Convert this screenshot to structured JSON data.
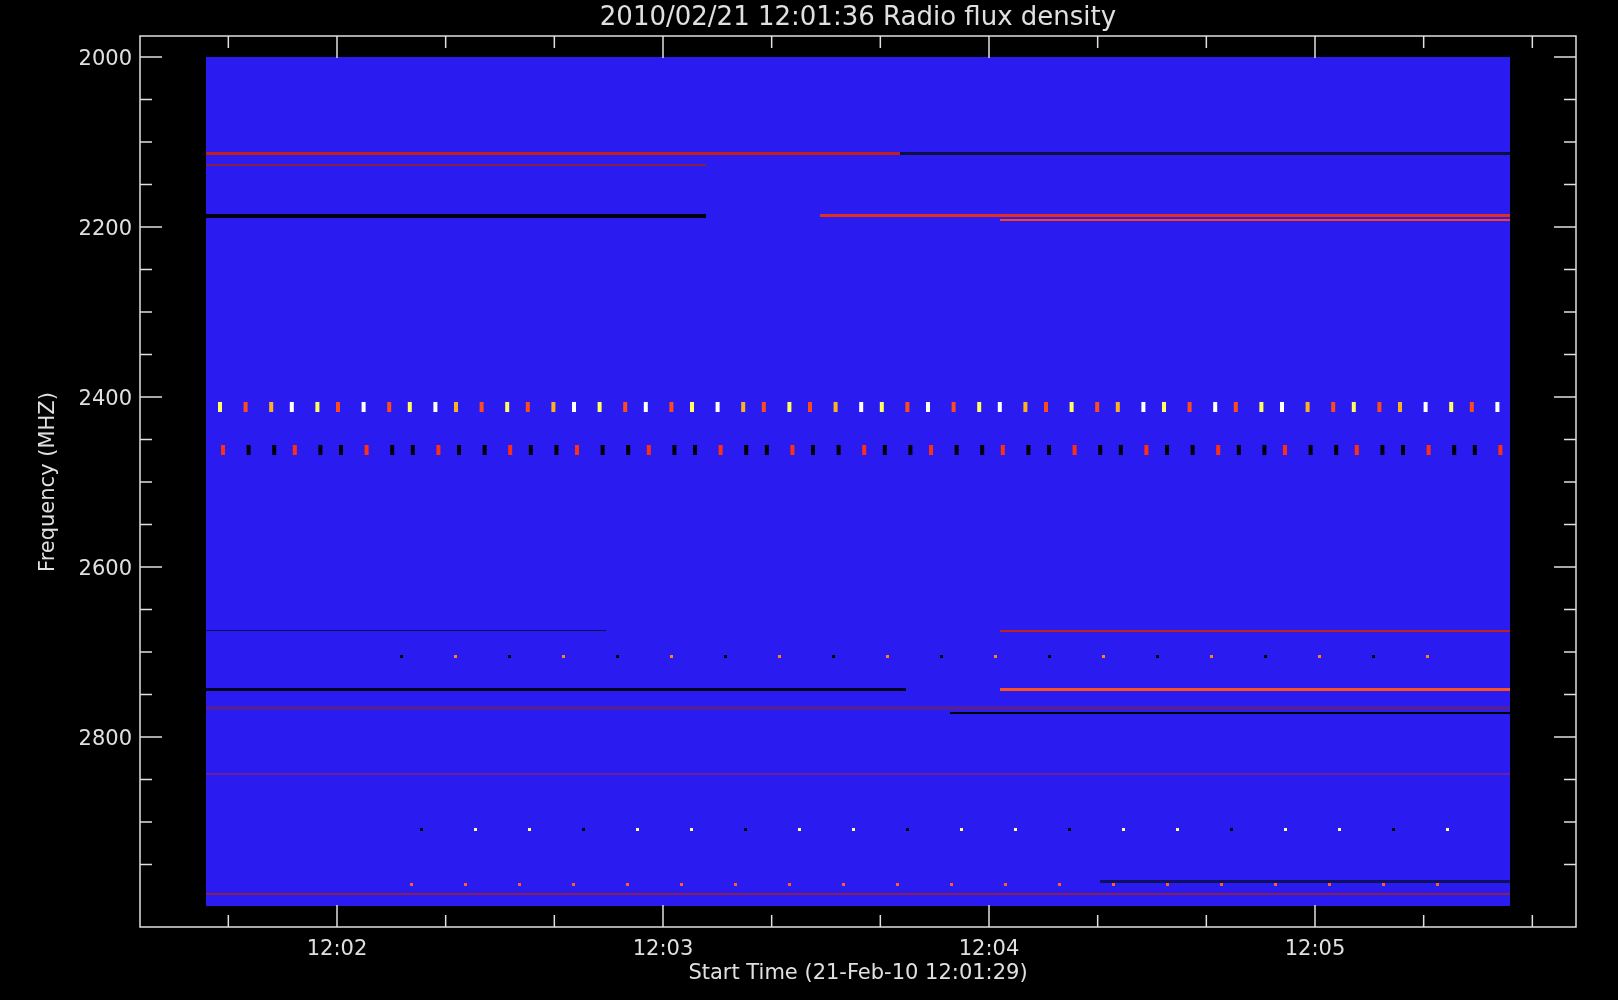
{
  "plot": {
    "title": "2010/02/21 12:01:36 Radio flux density",
    "xlabel": "Start Time (21-Feb-10 12:01:29)",
    "ylabel": "Frequency (MHZ)",
    "xtick_labels": [
      "12:02",
      "12:03",
      "12:04",
      "12:05"
    ],
    "ytick_labels": [
      "2000",
      "2200",
      "2400",
      "2600",
      "2800"
    ]
  }
}
